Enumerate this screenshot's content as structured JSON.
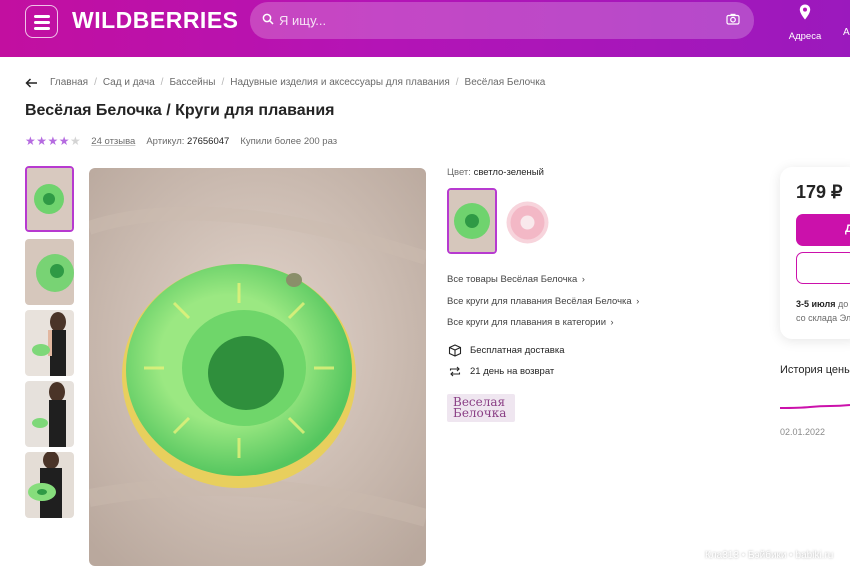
{
  "header": {
    "logo": "WILDBERRIES",
    "search_placeholder": "Я ищу...",
    "address_label": "Адреса",
    "edge_text": "А",
    "brand_color": "#cb11ab"
  },
  "breadcrumbs": [
    "Главная",
    "Сад и дача",
    "Бассейны",
    "Надувные изделия и аксессуары для плавания",
    "Весёлая Белочка"
  ],
  "product": {
    "title": "Весёлая Белочка / Круги для плавания",
    "rating": 4,
    "rating_max": 5,
    "reviews": "24 отзыва",
    "article_label": "Артикул:",
    "article": "27656047",
    "bought": "Купили более 200 раз"
  },
  "gallery": {
    "thumbnails": [
      "green-ring",
      "green-ring-side",
      "girl-with-ring",
      "girl-with-ring-2",
      "girl-holding-ring"
    ],
    "active_index": 0
  },
  "options": {
    "color_label": "Цвет:",
    "color_value": "светло-зеленый",
    "swatches": [
      "светло-зеленый",
      "розовый"
    ]
  },
  "links": [
    "Все товары Весёлая Белочка",
    "Все круги для плавания Весёлая Белочка",
    "Все круги для плавания в категории"
  ],
  "features": {
    "delivery": "Бесплатная доставка",
    "returns": "21 день на возврат"
  },
  "brand_logo": {
    "line1": "Веселая",
    "line2": "Белочка"
  },
  "buy_box": {
    "price": "179 ₽",
    "cart_button": "Д",
    "delivery_date": "3-5 июля",
    "delivery_tail": "до",
    "warehouse": "со склада Эл"
  },
  "price_history": {
    "title": "История цены",
    "date": "02.01.2022"
  },
  "watermark": "Кла313 • Бэйбики • babiki.ru"
}
